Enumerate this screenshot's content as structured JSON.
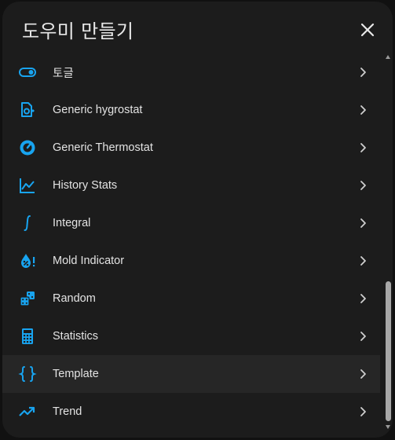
{
  "dialog": {
    "title": "도우미 만들기",
    "close_icon": "close-icon"
  },
  "colors": {
    "accent": "#18a4f0",
    "background": "#1c1c1c",
    "highlight": "#262626",
    "text": "#e3e3e3"
  },
  "items": [
    {
      "label": "토글",
      "icon": "toggle-switch-icon"
    },
    {
      "label": "Generic hygrostat",
      "icon": "hygrostat-icon"
    },
    {
      "label": "Generic Thermostat",
      "icon": "thermostat-icon"
    },
    {
      "label": "History Stats",
      "icon": "chart-line-icon"
    },
    {
      "label": "Integral",
      "icon": "integral-icon"
    },
    {
      "label": "Mold Indicator",
      "icon": "mold-drop-icon"
    },
    {
      "label": "Random",
      "icon": "dice-icon"
    },
    {
      "label": "Statistics",
      "icon": "calculator-icon"
    },
    {
      "label": "Template",
      "icon": "code-braces-icon"
    },
    {
      "label": "Trend",
      "icon": "trending-up-icon"
    }
  ]
}
